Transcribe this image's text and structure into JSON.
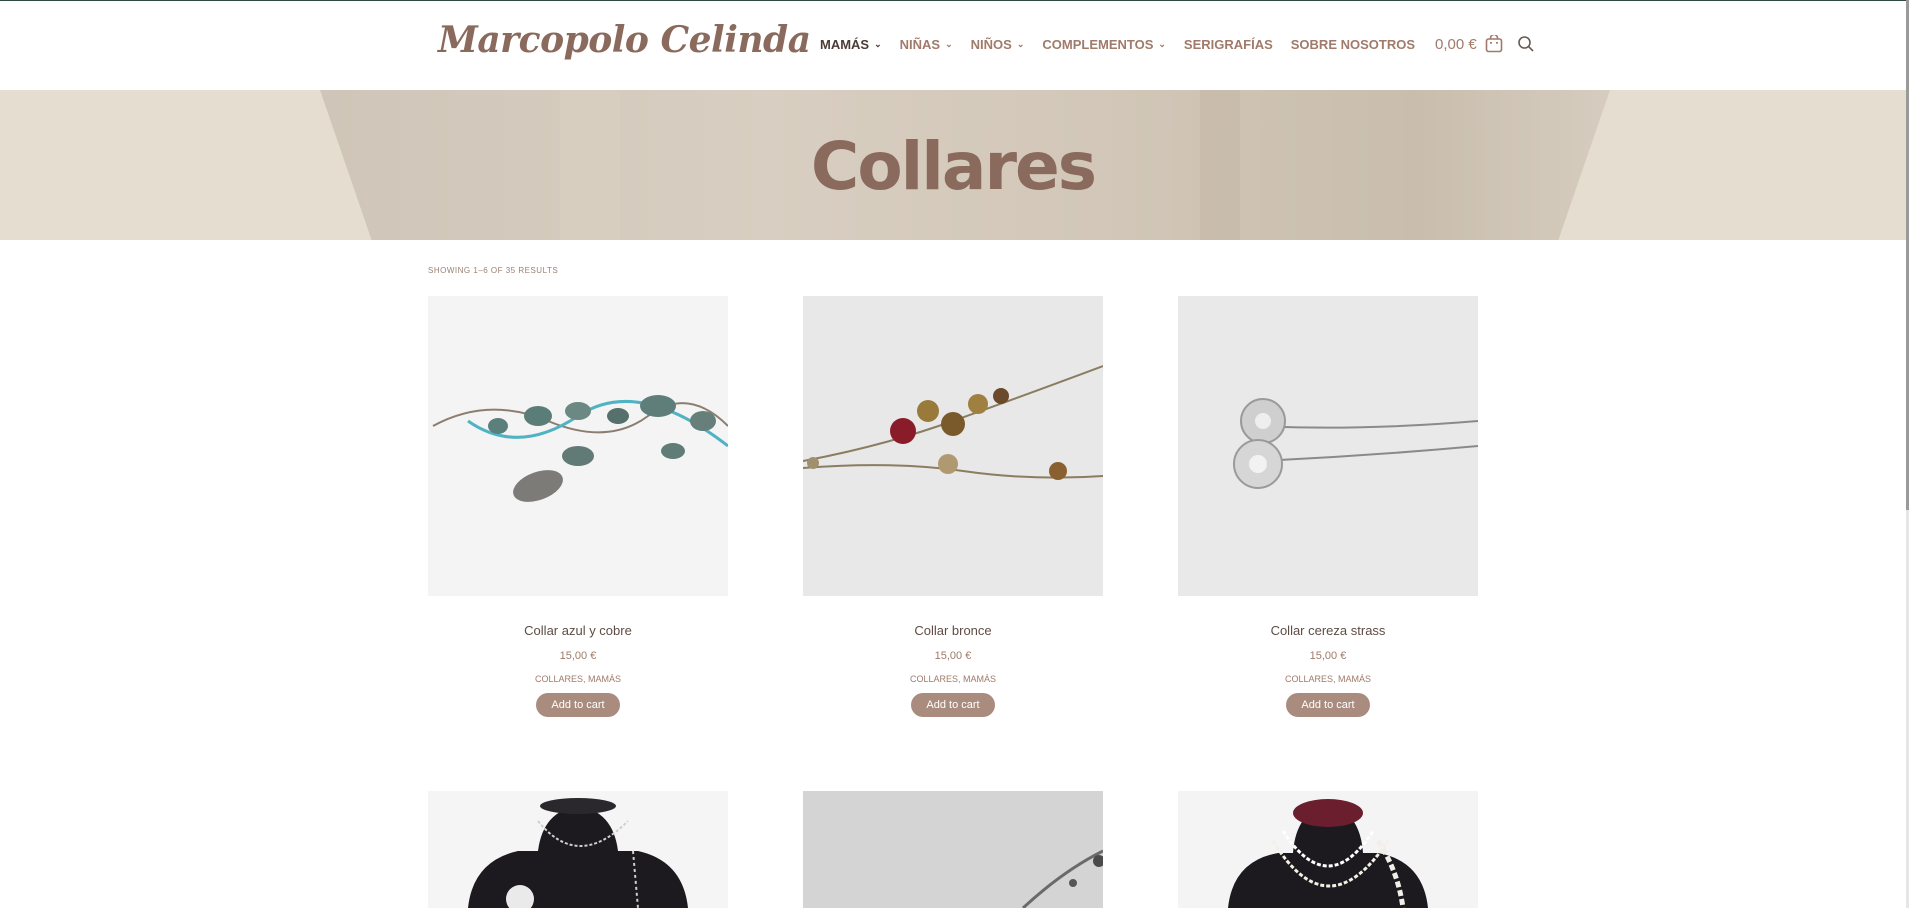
{
  "brand": {
    "name": "Marcopolo Celinda"
  },
  "nav": {
    "items": [
      {
        "label": "MAMÁS",
        "dropdown": true,
        "active": true
      },
      {
        "label": "NIÑAS",
        "dropdown": true
      },
      {
        "label": "NIÑOS",
        "dropdown": true
      },
      {
        "label": "COMPLEMENTOS",
        "dropdown": true
      },
      {
        "label": "SERIGRAFÍAS",
        "dropdown": false
      },
      {
        "label": "SOBRE NOSOTROS",
        "dropdown": false
      }
    ],
    "cart_total": "0,00 €"
  },
  "hero": {
    "title": "Collares"
  },
  "results_text": "SHOWING 1–6 OF 35 RESULTS",
  "products": [
    {
      "title": "Collar azul y cobre",
      "price": "15,00 €",
      "cat1": "COLLARES",
      "cat2": "MAMÁS",
      "button": "Add to cart"
    },
    {
      "title": "Collar bronce",
      "price": "15,00 €",
      "cat1": "COLLARES",
      "cat2": "MAMÁS",
      "button": "Add to cart"
    },
    {
      "title": "Collar cereza strass",
      "price": "15,00 €",
      "cat1": "COLLARES",
      "cat2": "MAMÁS",
      "button": "Add to cart"
    }
  ],
  "colors": {
    "accent": "#a98c7e",
    "brand": "#8a6a5c",
    "hero_bg": "#e5ddd0"
  }
}
